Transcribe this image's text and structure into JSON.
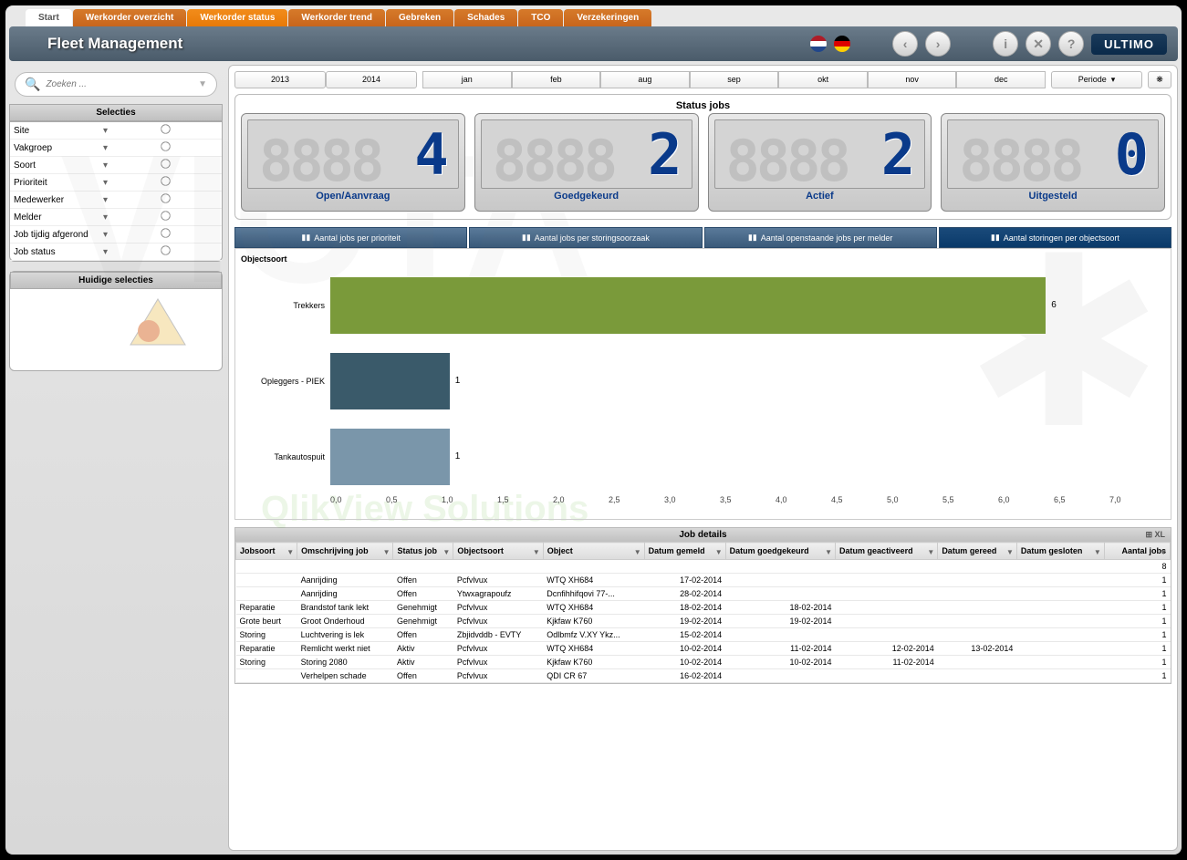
{
  "tabs": [
    "Start",
    "Werkorder overzicht",
    "Werkorder status",
    "Werkorder trend",
    "Gebreken",
    "Schades",
    "TCO",
    "Verzekeringen"
  ],
  "activeTabIndex": 2,
  "appTitle": "Fleet Management",
  "logo": "ULTIMO",
  "search": {
    "placeholder": "Zoeken ..."
  },
  "selecties": {
    "title": "Selecties",
    "items": [
      "Site",
      "Vakgroep",
      "Soort",
      "Prioriteit",
      "Medewerker",
      "Melder",
      "Job tijdig afgerond",
      "Job status"
    ]
  },
  "huidige": {
    "title": "Huidige selecties"
  },
  "timeline": {
    "years": [
      "2013",
      "2014"
    ],
    "months": [
      "jan",
      "feb",
      "aug",
      "sep",
      "okt",
      "nov",
      "dec"
    ],
    "periode": "Periode"
  },
  "statusJobs": {
    "title": "Status jobs",
    "cards": [
      {
        "label": "Open/Aanvraag",
        "value": "4"
      },
      {
        "label": "Goedgekeurd",
        "value": "2"
      },
      {
        "label": "Actief",
        "value": "2"
      },
      {
        "label": "Uitgesteld",
        "value": "0"
      }
    ]
  },
  "chartTabs": [
    "Aantal jobs per prioriteit",
    "Aantal jobs per storingsoorzaak",
    "Aantal openstaande jobs per melder",
    "Aantal storingen per objectsoort"
  ],
  "chartTabActive": 3,
  "chart_data": {
    "type": "bar",
    "orientation": "horizontal",
    "title": "Objectsoort",
    "categories": [
      "Trekkers",
      "Opleggers - PIEK",
      "Tankautospuit"
    ],
    "values": [
      6,
      1,
      1
    ],
    "colors": [
      "#7a9a3a",
      "#3a5a6a",
      "#7a96aa"
    ],
    "xlim": [
      0,
      7
    ],
    "xticks": [
      "0,0",
      "0,5",
      "1,0",
      "1,5",
      "2,0",
      "2,5",
      "3,0",
      "3,5",
      "4,0",
      "4,5",
      "5,0",
      "5,5",
      "6,0",
      "6,5",
      "7,0"
    ]
  },
  "jobDetails": {
    "title": "Job details",
    "xl": "XL",
    "columns": [
      "Jobsoort",
      "Omschrijving job",
      "Status job",
      "Objectsoort",
      "Object",
      "Datum gemeld",
      "Datum goedgekeurd",
      "Datum geactiveerd",
      "Datum gereed",
      "Datum gesloten",
      "Aantal jobs"
    ],
    "totalRow": {
      "aantal": "8"
    },
    "rows": [
      {
        "jobsoort": "",
        "omschrijving": "Aanrijding",
        "status": "Offen",
        "objectsoort": "Pcfvlvux",
        "object": "WTQ XH684",
        "gemeld": "17-02-2014",
        "goedgekeurd": "",
        "geactiveerd": "",
        "gereed": "",
        "gesloten": "",
        "aantal": "1"
      },
      {
        "jobsoort": "",
        "omschrijving": "Aanrijding",
        "status": "Offen",
        "objectsoort": "Ytwxagrapoufz",
        "object": "Dcnfihhifqovi 77-...",
        "gemeld": "28-02-2014",
        "goedgekeurd": "",
        "geactiveerd": "",
        "gereed": "",
        "gesloten": "",
        "aantal": "1"
      },
      {
        "jobsoort": "Reparatie",
        "omschrijving": "Brandstof tank lekt",
        "status": "Genehmigt",
        "objectsoort": "Pcfvlvux",
        "object": "WTQ XH684",
        "gemeld": "18-02-2014",
        "goedgekeurd": "18-02-2014",
        "geactiveerd": "",
        "gereed": "",
        "gesloten": "",
        "aantal": "1"
      },
      {
        "jobsoort": "Grote beurt",
        "omschrijving": "Groot Onderhoud",
        "status": "Genehmigt",
        "objectsoort": "Pcfvlvux",
        "object": "Kjkfaw K760",
        "gemeld": "19-02-2014",
        "goedgekeurd": "19-02-2014",
        "geactiveerd": "",
        "gereed": "",
        "gesloten": "",
        "aantal": "1"
      },
      {
        "jobsoort": "Storing",
        "omschrijving": "Luchtvering is lek",
        "status": "Offen",
        "objectsoort": "Zbjidvddb - EVTY",
        "object": "Odlbmfz V.XY Ykz...",
        "gemeld": "15-02-2014",
        "goedgekeurd": "",
        "geactiveerd": "",
        "gereed": "",
        "gesloten": "",
        "aantal": "1"
      },
      {
        "jobsoort": "Reparatie",
        "omschrijving": "Remlicht werkt niet",
        "status": "Aktiv",
        "objectsoort": "Pcfvlvux",
        "object": "WTQ XH684",
        "gemeld": "10-02-2014",
        "goedgekeurd": "11-02-2014",
        "geactiveerd": "12-02-2014",
        "gereed": "13-02-2014",
        "gesloten": "",
        "aantal": "1"
      },
      {
        "jobsoort": "Storing",
        "omschrijving": "Storing 2080",
        "status": "Aktiv",
        "objectsoort": "Pcfvlvux",
        "object": "Kjkfaw K760",
        "gemeld": "10-02-2014",
        "goedgekeurd": "10-02-2014",
        "geactiveerd": "11-02-2014",
        "gereed": "",
        "gesloten": "",
        "aantal": "1"
      },
      {
        "jobsoort": "",
        "omschrijving": "Verhelpen schade",
        "status": "Offen",
        "objectsoort": "Pcfvlvux",
        "object": "QDI CR 67",
        "gemeld": "16-02-2014",
        "goedgekeurd": "",
        "geactiveerd": "",
        "gereed": "",
        "gesloten": "",
        "aantal": "1"
      }
    ]
  }
}
